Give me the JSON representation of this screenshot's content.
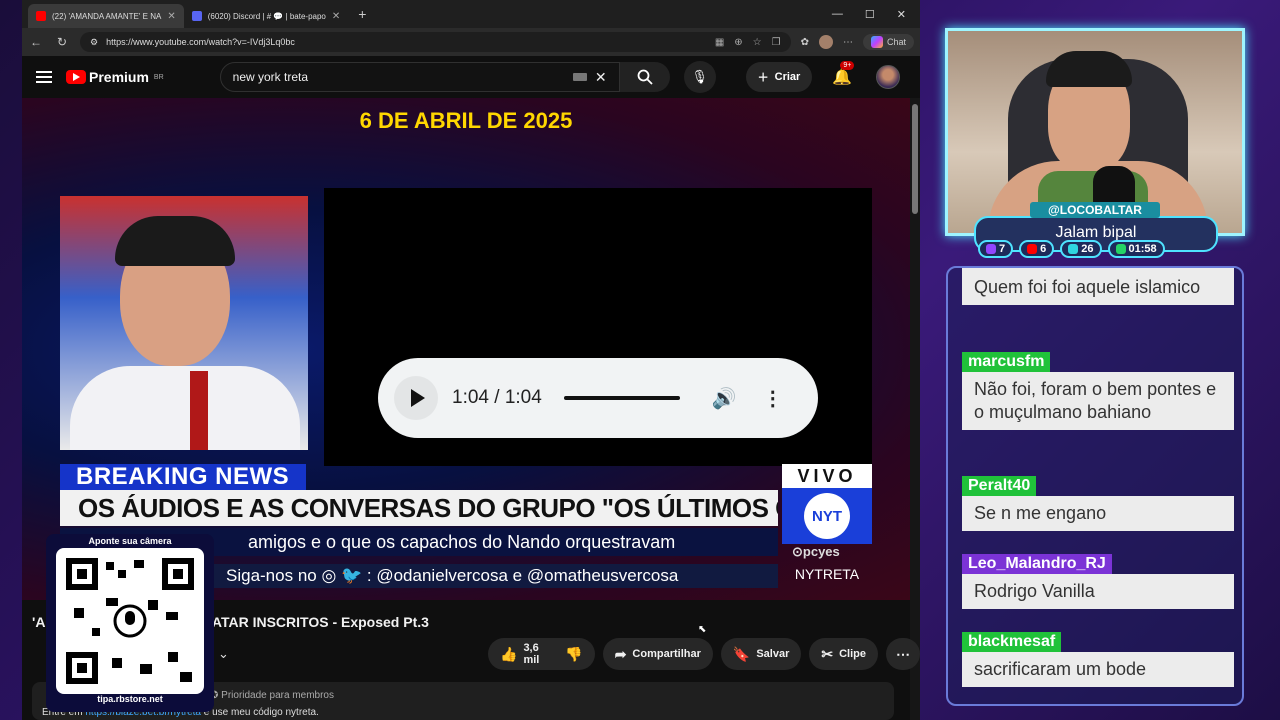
{
  "browser": {
    "tabs": [
      {
        "title": "(22) 'AMANDA AMANTE' E NA",
        "active": true,
        "favicon_color": "#ff0000"
      },
      {
        "title": "(6020) Discord | # 💬 | bate-papo",
        "active": false,
        "favicon_color": "#5865f2"
      }
    ],
    "new_tab": "+",
    "url": "https://www.youtube.com/watch?v=-IVdj3Lq0bc",
    "copilot_label": "Chat"
  },
  "youtube": {
    "logo_text": "Premium",
    "logo_region": "BR",
    "search_value": "new york treta",
    "create_label": "Criar",
    "notif_badge": "9+"
  },
  "video": {
    "date_banner": "6 DE ABRIL DE 2025",
    "audio_time": "1:04 / 1:04",
    "breaking": "BREAKING NEWS",
    "headline": "OS ÁUDIOS E AS CONVERSAS DO GRUPO \"OS ÚLTIMOS CAVALEIROS\"",
    "subline": "amigos e o que os capachos do Nando orquestravam",
    "follow": "Siga-nos no ◎ 🐦 : @odanielvercosa e @omatheusvercosa",
    "vivo": "VIVO",
    "nyt_logo": "NYT",
    "pcyes": "⊙pcyes",
    "channel_tag": "NYTRETA"
  },
  "below": {
    "title": "'A                    NDO PLANEJOU MALTRATAR INSCRITOS - Exposed Pt.3",
    "likes": "3,6 mil",
    "share": "Compartilhar",
    "save": "Salvar",
    "clip": "Clipe",
    "desc_meta": "✪ Prioridade para membros",
    "desc_pre": "Entre em ",
    "desc_link": "https://blaze.bet.br/nytreta",
    "desc_post": " e use meu código nytreta."
  },
  "overlay": {
    "handle": "@LOCOBALTAR",
    "game": "Jalam bipal",
    "stats": [
      {
        "value": "7",
        "color": "#9146ff"
      },
      {
        "value": "6",
        "color": "#ff0000"
      },
      {
        "value": "26",
        "color": "#2fd6e0"
      },
      {
        "value": "01:58",
        "color": "#25d366"
      }
    ],
    "chat": [
      {
        "user": "",
        "text": "Quem foi foi aquele islamico"
      },
      {
        "user": "marcusfm",
        "text": "Não foi, foram o bem pontes e o muçulmano bahiano"
      },
      {
        "user": "Peralt40",
        "text": "Se n me engano"
      },
      {
        "user": "Leo_Malandro_RJ",
        "text": "Rodrigo Vanilla"
      },
      {
        "user": "blackmesaf",
        "text": "sacrificaram um bode"
      }
    ],
    "qr_label": "Aponte sua câmera",
    "qr_site": "tipa.rbstore.net"
  }
}
